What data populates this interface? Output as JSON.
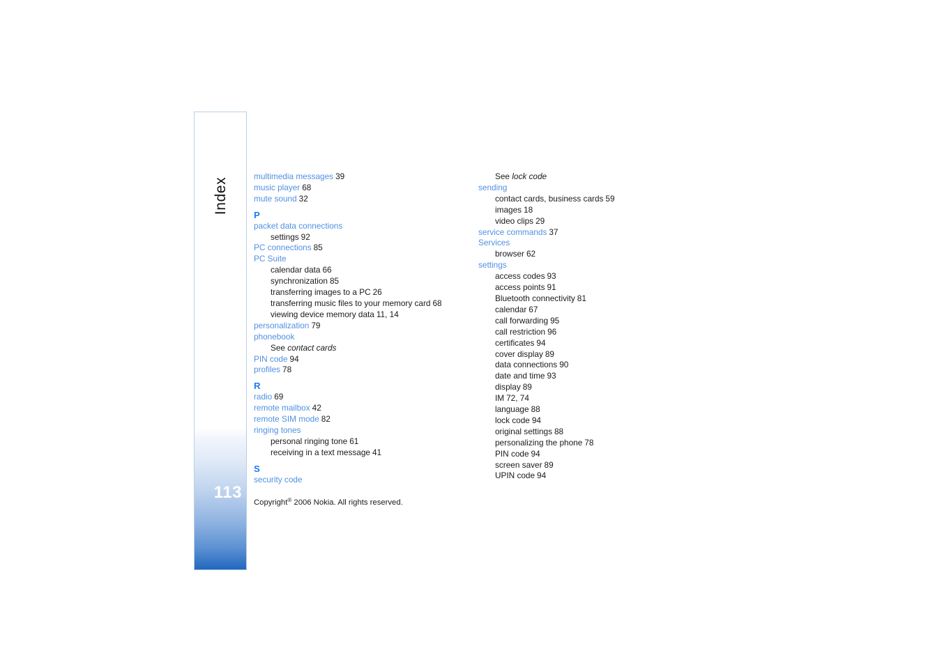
{
  "page": {
    "section_label": "Index",
    "page_number": "113",
    "copyright_prefix": "Copyright",
    "copyright_symbol": "®",
    "copyright_rest": "2006 Nokia. All rights reserved.",
    "accent_entry_color": "#5090e2",
    "accent_heading_color": "#1b7bf0",
    "tab_gradient_bottom": "#2168be",
    "tab_border_color": "#b9cfe3"
  },
  "columns": {
    "left": [
      {
        "type": "entry",
        "term": "multimedia messages",
        "pages": "39"
      },
      {
        "type": "entry",
        "term": "music player",
        "pages": "68"
      },
      {
        "type": "entry",
        "term": "mute sound",
        "pages": "32"
      },
      {
        "type": "letter",
        "term": "P"
      },
      {
        "type": "entry",
        "term": "packet data connections",
        "pages": ""
      },
      {
        "type": "subentry",
        "term": "settings",
        "pages": "92"
      },
      {
        "type": "entry",
        "term": "PC connections",
        "pages": "85"
      },
      {
        "type": "entry",
        "term": "PC Suite",
        "pages": ""
      },
      {
        "type": "subentry",
        "term": "calendar data",
        "pages": "66"
      },
      {
        "type": "subentry",
        "term": "synchronization",
        "pages": "85"
      },
      {
        "type": "subentry",
        "term": "transferring images to a PC",
        "pages": "26"
      },
      {
        "type": "subentry",
        "term": "transferring music files to your memory card",
        "pages": "68"
      },
      {
        "type": "subentry",
        "term": "viewing device memory data",
        "pages": "11, 14"
      },
      {
        "type": "entry",
        "term": "personalization",
        "pages": "79"
      },
      {
        "type": "entry",
        "term": "phonebook",
        "pages": ""
      },
      {
        "type": "see",
        "term": "See",
        "target": "contact cards"
      },
      {
        "type": "entry",
        "term": "PIN code",
        "pages": "94"
      },
      {
        "type": "entry",
        "term": "profiles",
        "pages": "78"
      },
      {
        "type": "letter",
        "term": "R"
      },
      {
        "type": "entry",
        "term": "radio",
        "pages": "69"
      },
      {
        "type": "entry",
        "term": "remote mailbox",
        "pages": "42"
      },
      {
        "type": "entry",
        "term": "remote SIM mode",
        "pages": "82"
      },
      {
        "type": "entry",
        "term": "ringing tones",
        "pages": ""
      },
      {
        "type": "subentry",
        "term": "personal ringing tone",
        "pages": "61"
      },
      {
        "type": "subentry",
        "term": "receiving in a text message",
        "pages": "41"
      },
      {
        "type": "letter",
        "term": "S"
      },
      {
        "type": "entry",
        "term": "security code",
        "pages": ""
      }
    ],
    "right": [
      {
        "type": "see",
        "term": "See",
        "target": "lock code"
      },
      {
        "type": "entry",
        "term": "sending",
        "pages": ""
      },
      {
        "type": "subentry",
        "term": "contact cards, business cards",
        "pages": "59"
      },
      {
        "type": "subentry",
        "term": "images",
        "pages": "18"
      },
      {
        "type": "subentry",
        "term": "video clips",
        "pages": "29"
      },
      {
        "type": "entry",
        "term": "service commands",
        "pages": "37"
      },
      {
        "type": "entry",
        "term": "Services",
        "pages": ""
      },
      {
        "type": "subentry",
        "term": "browser",
        "pages": "62"
      },
      {
        "type": "entry",
        "term": "settings",
        "pages": ""
      },
      {
        "type": "subentry",
        "term": "access codes",
        "pages": "93"
      },
      {
        "type": "subentry",
        "term": "access points",
        "pages": "91"
      },
      {
        "type": "subentry",
        "term": "Bluetooth connectivity",
        "pages": "81"
      },
      {
        "type": "subentry",
        "term": "calendar",
        "pages": "67"
      },
      {
        "type": "subentry",
        "term": "call forwarding",
        "pages": "95"
      },
      {
        "type": "subentry",
        "term": "call restriction",
        "pages": "96"
      },
      {
        "type": "subentry",
        "term": "certificates",
        "pages": "94"
      },
      {
        "type": "subentry",
        "term": "cover display",
        "pages": "89"
      },
      {
        "type": "subentry",
        "term": "data connections",
        "pages": "90"
      },
      {
        "type": "subentry",
        "term": "date and time",
        "pages": "93"
      },
      {
        "type": "subentry",
        "term": "display",
        "pages": "89"
      },
      {
        "type": "subentry",
        "term": "IM",
        "pages": "72, 74"
      },
      {
        "type": "subentry",
        "term": "language",
        "pages": "88"
      },
      {
        "type": "subentry",
        "term": "lock code",
        "pages": "94"
      },
      {
        "type": "subentry",
        "term": "original settings",
        "pages": "88"
      },
      {
        "type": "subentry",
        "term": "personalizing the phone",
        "pages": "78"
      },
      {
        "type": "subentry",
        "term": "PIN code",
        "pages": "94"
      },
      {
        "type": "subentry",
        "term": "screen saver",
        "pages": "89"
      },
      {
        "type": "subentry",
        "term": "UPIN code",
        "pages": "94"
      }
    ]
  }
}
